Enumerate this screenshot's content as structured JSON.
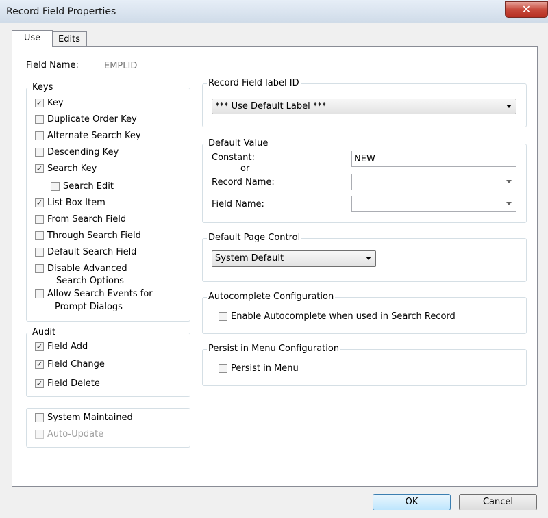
{
  "window": {
    "title": "Record Field Properties",
    "close_glyph": "✕"
  },
  "tabs": [
    {
      "label": "Use",
      "active": true
    },
    {
      "label": "Edits",
      "active": false
    }
  ],
  "field_name": {
    "label": "Field Name:",
    "value": "EMPLID"
  },
  "keys": {
    "title": "Keys",
    "items": [
      {
        "label": "Key",
        "checked": true
      },
      {
        "label": "Duplicate Order Key",
        "checked": false
      },
      {
        "label": "Alternate Search Key",
        "checked": false
      },
      {
        "label": "Descending Key",
        "checked": false
      },
      {
        "label": "Search Key",
        "checked": true
      },
      {
        "label": "Search Edit",
        "checked": false
      },
      {
        "label": "List Box Item",
        "checked": true
      },
      {
        "label": "From Search Field",
        "checked": false
      },
      {
        "label": "Through Search Field",
        "checked": false
      },
      {
        "label": "Default Search Field",
        "checked": false
      },
      {
        "label": "Disable Advanced",
        "label2": "Search Options",
        "checked": false
      },
      {
        "label": "Allow Search Events for",
        "label2": "Prompt Dialogs",
        "checked": false
      }
    ]
  },
  "audit": {
    "title": "Audit",
    "items": [
      {
        "label": "Field Add",
        "checked": true
      },
      {
        "label": "Field Change",
        "checked": true
      },
      {
        "label": "Field Delete",
        "checked": true
      }
    ]
  },
  "system": {
    "items": [
      {
        "label": "System Maintained",
        "checked": false,
        "disabled": false
      },
      {
        "label": "Auto-Update",
        "checked": false,
        "disabled": true
      }
    ]
  },
  "label_id": {
    "title": "Record Field label ID",
    "selected": "*** Use Default Label ***"
  },
  "default_value": {
    "title": "Default Value",
    "constant_label": "Constant:",
    "or_label": "or",
    "constant_value": "NEW",
    "record_name_label": "Record Name:",
    "record_name_value": "",
    "field_name_label": "Field Name:",
    "field_name_value": ""
  },
  "page_control": {
    "title": "Default Page Control",
    "selected": "System Default"
  },
  "autocomplete": {
    "title": "Autocomplete Configuration",
    "checkbox_label": "Enable Autocomplete when used in Search Record",
    "checked": false
  },
  "persist": {
    "title": "Persist in Menu Configuration",
    "checkbox_label": "Persist in Menu",
    "checked": false
  },
  "buttons": {
    "ok": "OK",
    "cancel": "Cancel"
  },
  "check_glyph": "✓"
}
